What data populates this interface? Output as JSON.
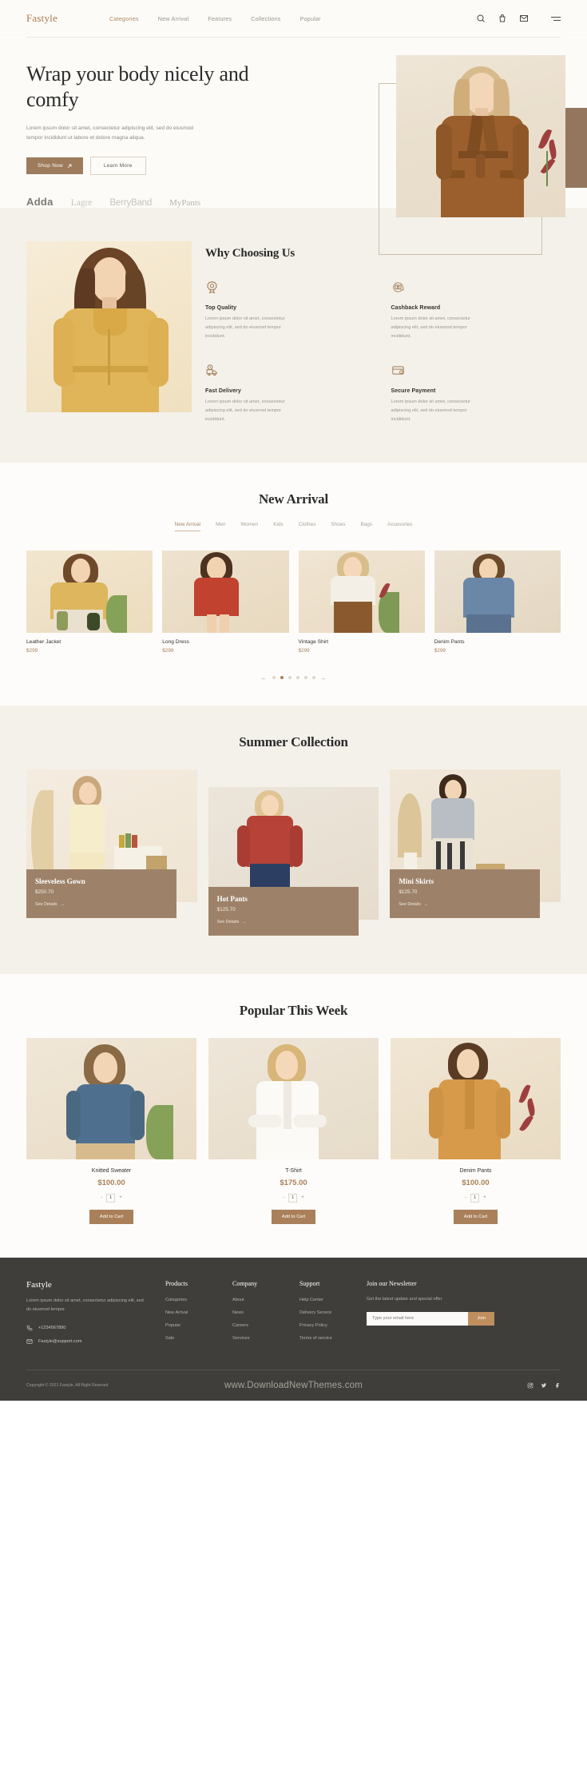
{
  "header": {
    "logo": "Fastyle",
    "nav": [
      {
        "label": "Categories",
        "active": true
      },
      {
        "label": "New Arrival",
        "active": false
      },
      {
        "label": "Features",
        "active": false
      },
      {
        "label": "Collections",
        "active": false
      },
      {
        "label": "Popular",
        "active": false
      }
    ],
    "icons": [
      "search-icon",
      "bag-icon",
      "mail-icon",
      "hamburger-icon"
    ]
  },
  "hero": {
    "title": "Wrap your body nicely and comfy",
    "subtitle": "Lorem ipsum dolor sit amet, consectetur adipiscing elit, sed do eiusmod tempor incididunt ut labore et dolore magna aliqua.",
    "primary_button": "Shop Now",
    "primary_button_icon": "arrow-up-right-icon",
    "secondary_button": "Learn More",
    "brands": [
      "Adda",
      "Lagre",
      "BerryBand",
      "MyPants"
    ]
  },
  "why": {
    "title": "Why Choosing Us",
    "features": [
      {
        "icon": "award-badge-icon",
        "title": "Top Quality",
        "text": "Lorem ipsum dolor sit amet, consectetur adipiscing elit, sed do eiusmod tempor incididunt."
      },
      {
        "icon": "cashback-money-icon",
        "title": "Cashback Reward",
        "text": "Lorem ipsum dolor sit amet, consectetur adipiscing elit, sed do eiusmod tempor incididunt."
      },
      {
        "icon": "delivery-truck-icon",
        "title": "Fast Delivery",
        "text": "Lorem ipsum dolor sit amet, consectetur adipiscing elit, sed do eiusmod tempor incididunt."
      },
      {
        "icon": "credit-card-icon",
        "title": "Secure Payment",
        "text": "Lorem ipsum dolor sit amet, consectetur adipiscing elit, sed do eiusmod tempor incididunt."
      }
    ]
  },
  "new_arrival": {
    "title": "New Arrival",
    "tabs": [
      {
        "label": "New Arrival",
        "active": true
      },
      {
        "label": "Men",
        "active": false
      },
      {
        "label": "Women",
        "active": false
      },
      {
        "label": "Kids",
        "active": false
      },
      {
        "label": "Clothes",
        "active": false
      },
      {
        "label": "Shoes",
        "active": false
      },
      {
        "label": "Bags",
        "active": false
      },
      {
        "label": "Accesories",
        "active": false
      }
    ],
    "products": [
      {
        "name": "Leather Jacket",
        "price": "$299"
      },
      {
        "name": "Long Dress",
        "price": "$299"
      },
      {
        "name": "Vintage Shirt",
        "price": "$299"
      },
      {
        "name": "Denim Pants",
        "price": "$299"
      }
    ],
    "pagination": {
      "dots": 6,
      "active_index": 1,
      "prev_icon": "arrow-left-icon",
      "next_icon": "arrow-right-icon"
    }
  },
  "summer": {
    "title": "Summer Collection",
    "cards": [
      {
        "name": "Sleeveless Gown",
        "price": "$250.70",
        "link": "See Details",
        "link_icon": "arrow-right-icon"
      },
      {
        "name": "Hot Pants",
        "price": "$125.70",
        "link": "See Details",
        "link_icon": "arrow-right-icon"
      },
      {
        "name": "Mini Skirts",
        "price": "$125.70",
        "link": "See Details",
        "link_icon": "arrow-right-icon"
      }
    ]
  },
  "popular": {
    "title": "Popular This Week",
    "products": [
      {
        "name": "Knitted Sweater",
        "price": "$100.00",
        "qty": "1",
        "button": "Add to Cart"
      },
      {
        "name": "T-Shirt",
        "price": "$175.00",
        "qty": "1",
        "button": "Add to Cart"
      },
      {
        "name": "Denim Pants",
        "price": "$100.00",
        "qty": "1",
        "button": "Add to Cart"
      }
    ]
  },
  "footer": {
    "logo": "Fastyle",
    "description": "Lorem ipsum dolor sit amet, consectetur adipiscing elit, sed do eiusmod tempor.",
    "phone": "+1234567890",
    "email": "Fastyle@support.com",
    "columns": [
      {
        "title": "Products",
        "items": [
          "Categories",
          "New Arrival",
          "Popular",
          "Sale"
        ]
      },
      {
        "title": "Company",
        "items": [
          "About",
          "News",
          "Careers",
          "Services"
        ]
      },
      {
        "title": "Support",
        "items": [
          "Help Center",
          "Delivery Service",
          "Privacy Policy",
          "Terms of service"
        ]
      }
    ],
    "newsletter": {
      "title": "Join our Newsletter",
      "text": "Get the latest update and special offer",
      "placeholder": "Type your email here",
      "button": "Join"
    },
    "copyright": "Copyright © 2021 Fastyle. All Right Reseved",
    "watermark": "www.DownloadNewThemes.com",
    "socials": [
      "instagram-icon",
      "twitter-icon",
      "facebook-icon"
    ]
  },
  "colors": {
    "accent": "#a9805a",
    "accent_dark": "#9d7b5b",
    "caption_bg": "#9d8269",
    "cream": "#fcfbf7",
    "beige": "#f4f1ea",
    "footer_bg": "#3f3e3b"
  }
}
